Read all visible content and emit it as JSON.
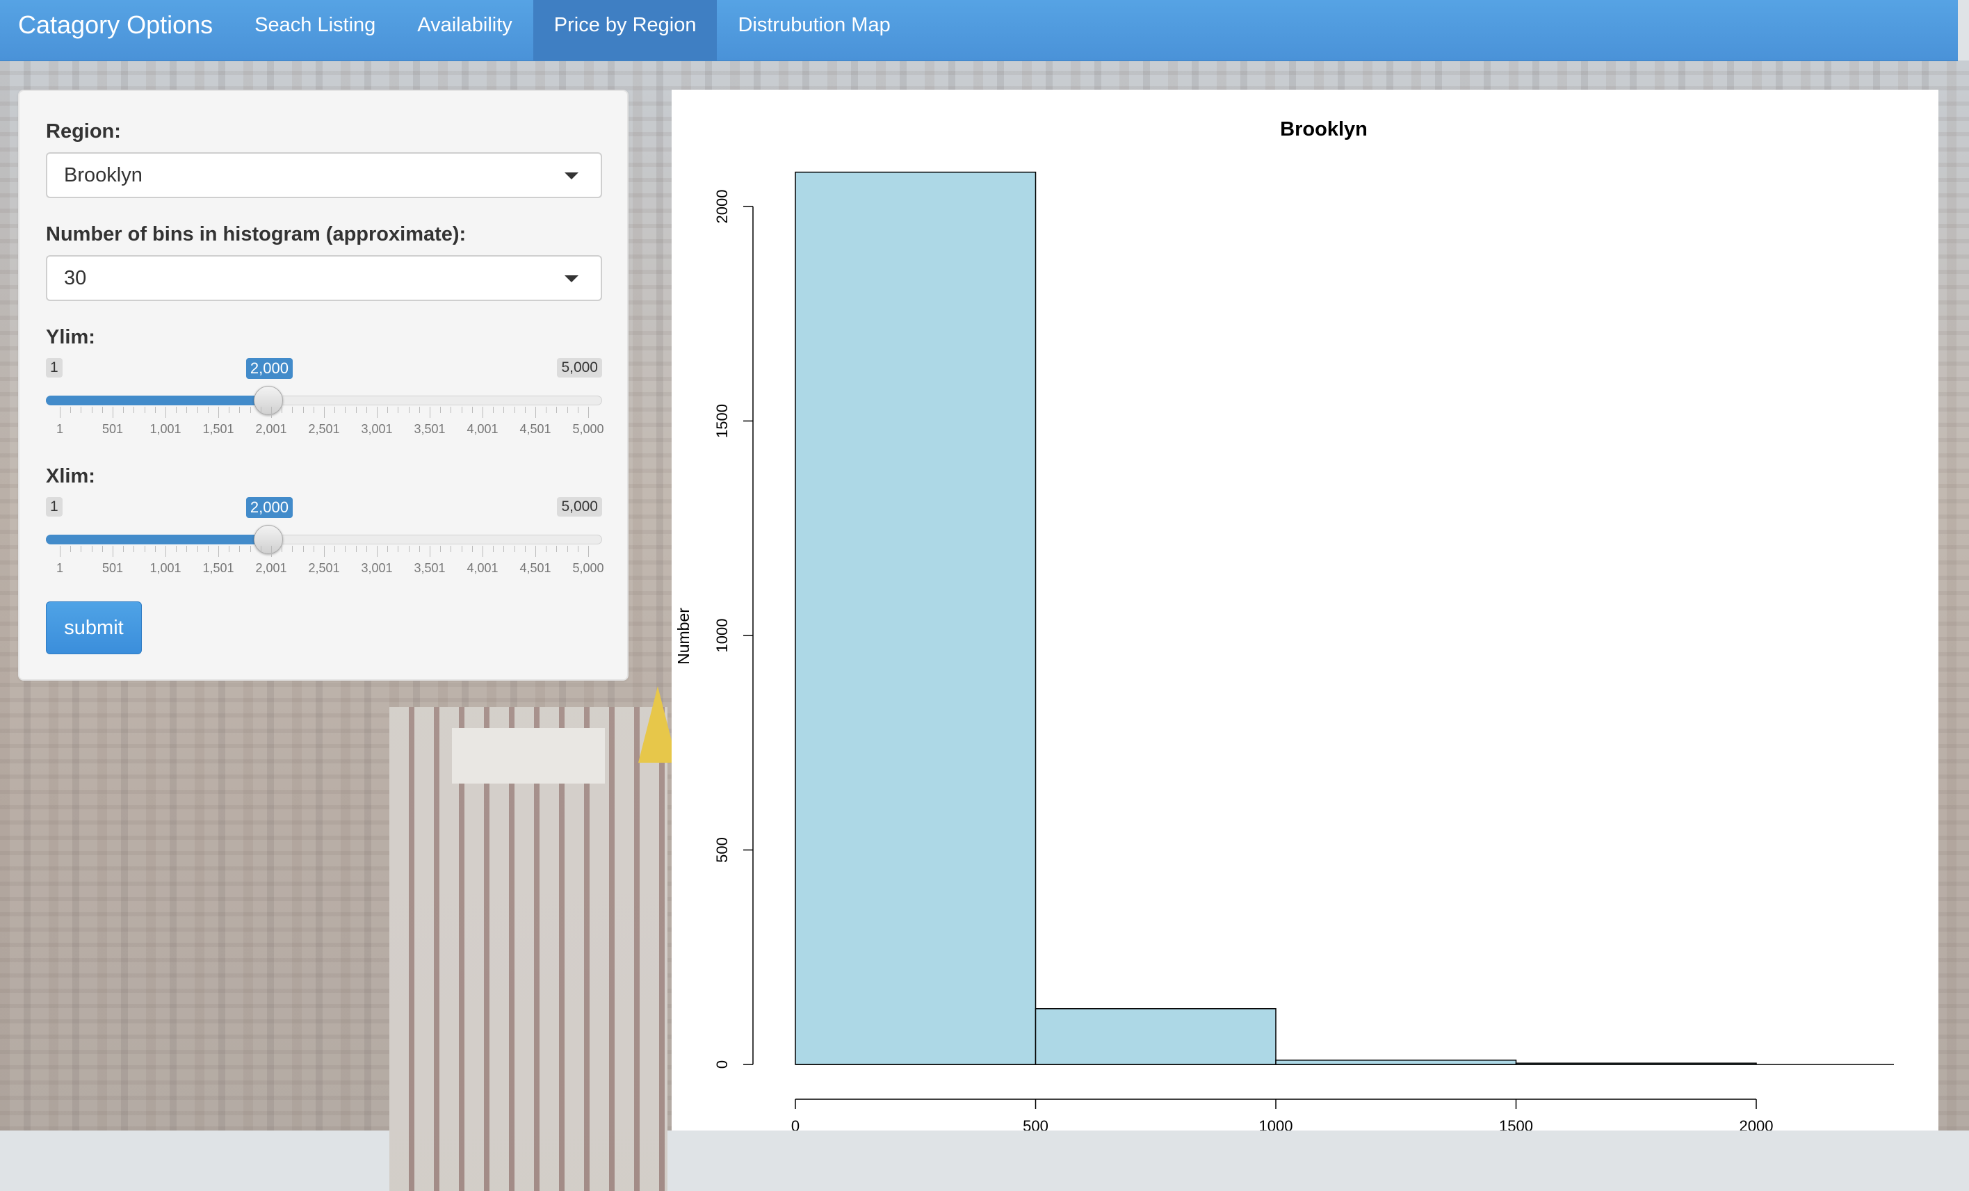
{
  "navbar": {
    "brand": "Catagory Options",
    "tabs": [
      {
        "label": "Seach Listing",
        "active": false
      },
      {
        "label": "Availability",
        "active": false
      },
      {
        "label": "Price by Region",
        "active": true
      },
      {
        "label": "Distrubution Map",
        "active": false
      }
    ],
    "color": "#4a92d8"
  },
  "sidebar": {
    "region_label": "Region:",
    "region_value": "Brooklyn",
    "bins_label": "Number of bins in histogram (approximate):",
    "bins_value": "30",
    "ylim": {
      "label": "Ylim:",
      "min_label": "1",
      "max_label": "5,000",
      "value_label": "2,000",
      "min": 1,
      "max": 5000,
      "value": 2000,
      "ticks": [
        "1",
        "501",
        "1,001",
        "1,501",
        "2,001",
        "2,501",
        "3,001",
        "3,501",
        "4,001",
        "4,501",
        "5,000"
      ]
    },
    "xlim": {
      "label": "Xlim:",
      "min_label": "1",
      "max_label": "5,000",
      "value_label": "2,000",
      "min": 1,
      "max": 5000,
      "value": 2000,
      "ticks": [
        "1",
        "501",
        "1,001",
        "1,501",
        "2,001",
        "2,501",
        "3,001",
        "3,501",
        "4,001",
        "4,501",
        "5,000"
      ]
    },
    "submit_label": "submit",
    "accent": "#428bca"
  },
  "chart_data": {
    "type": "bar",
    "title": "Brooklyn",
    "xlabel": "",
    "ylabel": "Number",
    "bins": [
      {
        "x0": 0,
        "x1": 500,
        "value": 2080
      },
      {
        "x0": 500,
        "x1": 1000,
        "value": 130
      },
      {
        "x0": 1000,
        "x1": 1500,
        "value": 10
      },
      {
        "x0": 1500,
        "x1": 2000,
        "value": 3
      }
    ],
    "xlim": [
      0,
      2000
    ],
    "ylim": [
      0,
      2000
    ],
    "xticks": [
      0,
      500,
      1000,
      1500,
      2000
    ],
    "yticks": [
      0,
      500,
      1000,
      1500,
      2000
    ],
    "bar_color": "#add8e6",
    "grid": false
  }
}
